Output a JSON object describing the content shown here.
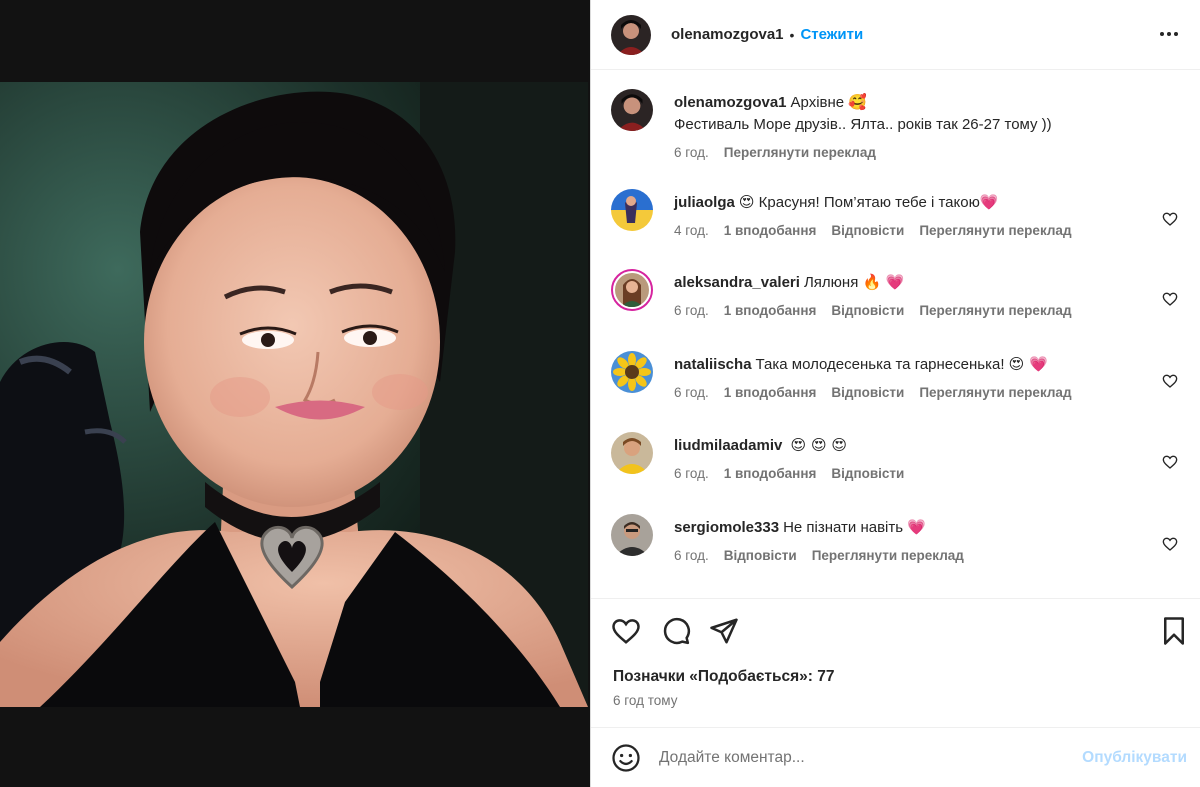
{
  "post": {
    "author": "olenamozgova1",
    "separator": "•",
    "follow_label": "Стежити"
  },
  "caption": {
    "username": "olenamozgova1",
    "text_line1": "Архівне",
    "emoji": "🥰",
    "text_line2": "Фестиваль Море друзів.. Ялта.. років так 26-27 тому ))",
    "time": "6 год.",
    "translate": "Переглянути переклад"
  },
  "comments": [
    {
      "username": "juliaolga",
      "prefix_emoji": "😍",
      "text": "Красуня! Пом’ятаю тебе і такою",
      "suffix_emoji": "💗",
      "time": "4 год.",
      "likes": "1 вподобання",
      "reply": "Відповісти",
      "translate": "Переглянути переклад"
    },
    {
      "username": "aleksandra_valeri",
      "prefix_emoji": "",
      "text": "Лялюня",
      "suffix_emoji": "🔥 💗",
      "time": "6 год.",
      "likes": "1 вподобання",
      "reply": "Відповісти",
      "translate": "Переглянути переклад"
    },
    {
      "username": "nataliischa",
      "prefix_emoji": "",
      "text": "Така молодесенька та гарнесенька!",
      "suffix_emoji": "😍 💗",
      "time": "6 год.",
      "likes": "1 вподобання",
      "reply": "Відповісти",
      "translate": "Переглянути переклад"
    },
    {
      "username": "liudmilaadamiv",
      "prefix_emoji": "",
      "text": "",
      "suffix_emoji": "😍 😍 😍",
      "time": "6 год.",
      "likes": "1 вподобання",
      "reply": "Відповісти",
      "translate": ""
    },
    {
      "username": "sergiomole333",
      "prefix_emoji": "",
      "text": "Не пізнати навіть",
      "suffix_emoji": "💗",
      "time": "6 год.",
      "likes": "",
      "reply": "Відповісти",
      "translate": "Переглянути переклад"
    }
  ],
  "likes": {
    "label": "Позначки «Подобається»:",
    "count": "77"
  },
  "post_time": "6 год тому",
  "comment_box": {
    "placeholder": "Додайте коментар...",
    "post_label": "Опублікувати"
  },
  "icons": {
    "more": "more-options-icon",
    "like": "heart-icon",
    "comment": "comment-icon",
    "share": "share-icon",
    "save": "bookmark-icon",
    "emoji": "emoji-icon"
  },
  "colors": {
    "accent": "#0095f6",
    "post_disabled": "#b3dbff",
    "heart": "#e8336b",
    "muted": "#737373"
  }
}
